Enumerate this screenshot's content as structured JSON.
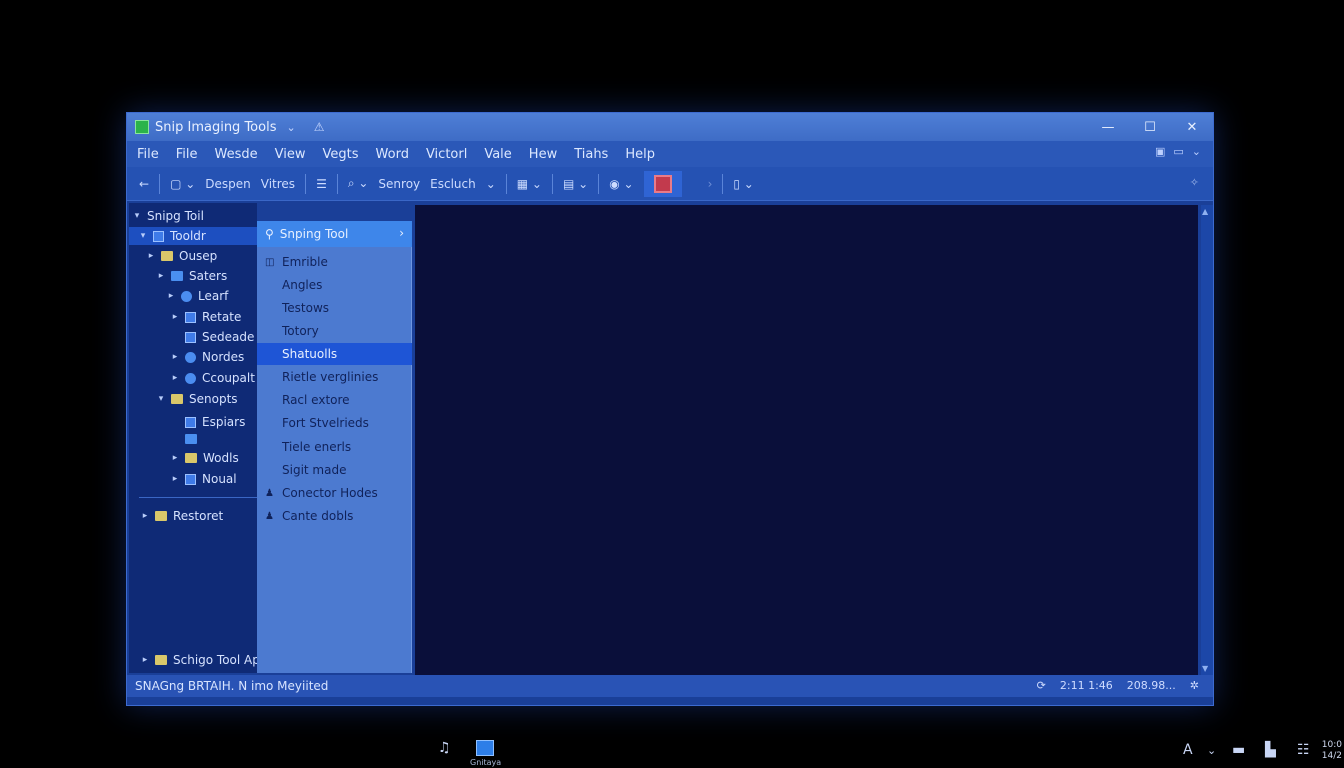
{
  "window": {
    "title": "Snip Imaging Tools"
  },
  "menu": [
    "File",
    "File",
    "Wesde",
    "View",
    "Vegts",
    "Word",
    "Victorl",
    "Vale",
    "Hew",
    "Tiahs",
    "Help"
  ],
  "toolbar": {
    "label1": "Despen",
    "label2": "Vitres",
    "label3": "Senroy",
    "label4": "Escluch"
  },
  "tree": {
    "items": [
      {
        "label": "Snipg Toil",
        "expander": "▾"
      },
      {
        "label": "Tooldr",
        "expander": "▾"
      },
      {
        "label": "Ousep",
        "expander": "▸"
      },
      {
        "label": "Saters",
        "expander": "▸"
      },
      {
        "label": "Learf",
        "expander": "▸"
      },
      {
        "label": "Retate",
        "expander": "▸"
      },
      {
        "label": "Sedeade",
        "expander": ""
      },
      {
        "label": "Nordes",
        "expander": "▸"
      },
      {
        "label": "Ccoupalt",
        "expander": "▸"
      },
      {
        "label": "Senopts",
        "expander": "▾"
      },
      {
        "label": "Espiars",
        "expander": ""
      },
      {
        "label": "Wodls",
        "expander": "▸"
      },
      {
        "label": "Noual",
        "expander": "▸"
      },
      {
        "label": "Restoret",
        "expander": "▸"
      }
    ],
    "bottom_label": "Schigo Tool Apr"
  },
  "flyout": {
    "header": "Snping Tool",
    "items": [
      "Emrible",
      "Angles",
      "Testows",
      "Totory",
      "Shatuolls",
      "Rietle verglinies",
      "Racl extore",
      "Fort Stvelrieds",
      "Tiele enerls",
      "Sigit made",
      "Conector Hodes",
      "Cante dobls"
    ],
    "highlighted_index": 4
  },
  "status": {
    "left": "SNAGng BRTAIH. N imo Meyiited",
    "time": "2:11 1:46",
    "extra": "208.98..."
  },
  "taskbar": {
    "app_label": "Gnitaya",
    "clock_line1": "10:0",
    "clock_line2": "14/2"
  },
  "colors": {
    "accent": "#3e86ea",
    "editor_bg": "#0a0f3a",
    "window_bg": "#1a3f98"
  }
}
